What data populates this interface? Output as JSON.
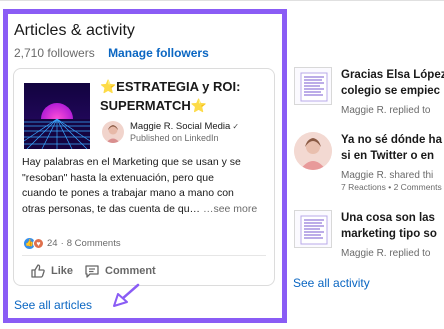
{
  "articles": {
    "title": "Articles & activity",
    "followers": "2,710 followers",
    "manage_followers": "Manage followers",
    "card": {
      "title": "⭐ESTRATEGIA y ROI: SUPERMATCH⭐",
      "author": "Maggie R. Social Media",
      "published": "Published on LinkedIn",
      "text_lines": [
        "Hay palabras en el Marketing que se usan y se",
        "\"resoban\" hasta la extenuación, pero que",
        "cuando te pones a trabajar mano a mano con",
        "otras personas, te das cuenta de qu…"
      ],
      "see_more": "…see more",
      "reaction_count": "24",
      "comment_count": "8 Comments",
      "like_label": "Like",
      "comment_label": "Comment"
    },
    "see_all": "See all articles"
  },
  "activity": {
    "items": [
      {
        "title_lines": [
          "Gracias Elsa López",
          "colegio se empiec"
        ],
        "meta": "Maggie R. replied to",
        "reactions": ""
      },
      {
        "title_lines": [
          "Ya no sé dónde ha",
          "si en Twitter o en"
        ],
        "meta": "Maggie R. shared thi",
        "reactions": "7 Reactions • 2 Comments"
      },
      {
        "title_lines": [
          "Una cosa son las",
          "marketing tipo so"
        ],
        "meta": "Maggie R. replied to",
        "reactions": ""
      }
    ],
    "see_all": "See all activity"
  },
  "colors": {
    "highlight_border": "#8a5cf5",
    "link": "#0a66c2",
    "arrow": "#8a5cf5"
  },
  "icons": [
    "verified-icon",
    "like-reaction-icon",
    "love-reaction-icon",
    "like-icon",
    "comment-icon",
    "arrow-pointer-icon"
  ]
}
